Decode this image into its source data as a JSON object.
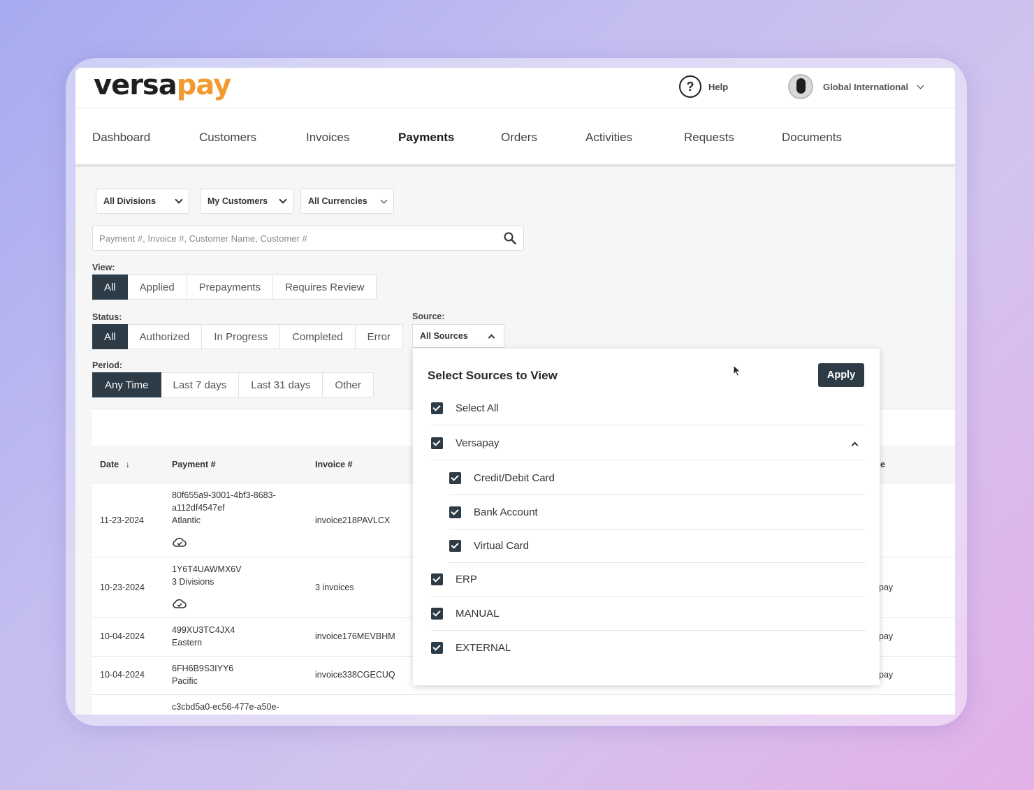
{
  "app": {
    "logo_part1": "versa",
    "logo_part2": "pay",
    "help_label": "Help",
    "account_name": "Global International"
  },
  "nav": [
    {
      "label": "Dashboard"
    },
    {
      "label": "Customers"
    },
    {
      "label": "Invoices"
    },
    {
      "label": "Payments",
      "active": true
    },
    {
      "label": "Orders"
    },
    {
      "label": "Activities"
    },
    {
      "label": "Requests"
    },
    {
      "label": "Documents"
    }
  ],
  "filters": {
    "divisions": "All Divisions",
    "customers": "My Customers",
    "currencies": "All Currencies",
    "search_placeholder": "Payment #, Invoice #, Customer Name, Customer #"
  },
  "view": {
    "label": "View:",
    "options": [
      "All",
      "Applied",
      "Prepayments",
      "Requires Review"
    ],
    "selected": "All"
  },
  "status": {
    "label": "Status:",
    "options": [
      "All",
      "Authorized",
      "In Progress",
      "Completed",
      "Error"
    ],
    "selected": "All"
  },
  "source": {
    "label": "Source:",
    "value": "All Sources"
  },
  "period": {
    "label": "Period:",
    "options": [
      "Any Time",
      "Last 7 days",
      "Last 31 days",
      "Other"
    ],
    "selected": "Any Time"
  },
  "table": {
    "headers": {
      "date": "Date",
      "payment": "Payment #",
      "invoice": "Invoice #",
      "last_col_fragment": "e"
    },
    "rows": [
      {
        "date": "11-23-2024",
        "payment_line1": "80f655a9-3001-4bf3-8683-",
        "payment_line2": "a112df4547ef",
        "division": "Atlantic",
        "invoice": "invoice218PAVLCX",
        "right": ""
      },
      {
        "date": "10-23-2024",
        "payment_line1": "1Y6T4UAWMX6V",
        "division": "3 Divisions",
        "invoice": "3 invoices",
        "right": "pay"
      },
      {
        "date": "10-04-2024",
        "payment_line1": "499XU3TC4JX4",
        "division": "Eastern",
        "invoice": "invoice176MEVBHM",
        "right": "pay"
      },
      {
        "date": "10-04-2024",
        "payment_line1": "6FH6B9S3IYY6",
        "division": "Pacific",
        "invoice": "invoice338CGECUQ",
        "right": "pay"
      },
      {
        "payment_line1": "c3cbd5a0-ec56-477e-a50e-"
      }
    ]
  },
  "sources_popup": {
    "title": "Select Sources to View",
    "apply_label": "Apply",
    "select_all": {
      "label": "Select All",
      "checked": true
    },
    "groups": [
      {
        "label": "Versapay",
        "checked": true,
        "expanded": true,
        "children": [
          {
            "label": "Credit/Debit Card",
            "checked": true
          },
          {
            "label": "Bank Account",
            "checked": true
          },
          {
            "label": "Virtual Card",
            "checked": true
          }
        ]
      },
      {
        "label": "ERP",
        "checked": true
      },
      {
        "label": "MANUAL",
        "checked": true
      },
      {
        "label": "EXTERNAL",
        "checked": true
      }
    ]
  },
  "colors": {
    "accent_dark": "#2c3b45",
    "logo_orange": "#f29a2e"
  }
}
